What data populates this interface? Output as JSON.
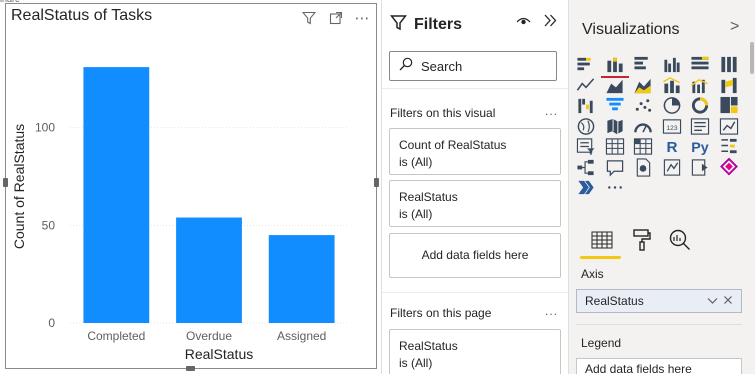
{
  "visual": {
    "cut_text": "ihare",
    "title": "RealStatus of Tasks",
    "header_icons": [
      "filter-icon",
      "focus-mode-icon",
      "more-options-icon"
    ],
    "more_label": "⋯"
  },
  "chart_data": {
    "type": "bar",
    "title": "RealStatus of Tasks",
    "xlabel": "RealStatus",
    "ylabel": "Count of RealStatus",
    "categories": [
      "Completed",
      "Overdue",
      "Assigned"
    ],
    "values": [
      131,
      54,
      45
    ],
    "yticks": [
      0,
      50,
      100
    ],
    "ylim": [
      0,
      150
    ],
    "grid": true,
    "bar_color": "#118DFF"
  },
  "filters": {
    "title": "Filters",
    "search_placeholder": "Search",
    "on_visual_label": "Filters on this visual",
    "on_page_label": "Filters on this page",
    "more_label": "...",
    "visual_cards": [
      {
        "name": "Count of RealStatus",
        "state": "is (All)"
      },
      {
        "name": "RealStatus",
        "state": "is (All)"
      }
    ],
    "add_fields": "Add data fields here",
    "page_cards": [
      {
        "name": "RealStatus",
        "state": "is (All)"
      }
    ]
  },
  "visualizations": {
    "title": "Visualizations",
    "chevron": ">",
    "more_label": "...",
    "axis_label": "Axis",
    "axis_value": "RealStatus",
    "legend_label": "Legend",
    "legend_placeholder": "Add data fields here",
    "r_label": "R",
    "py_label": "Py",
    "icons": [
      "stacked-bar-icon",
      "stacked-column-icon",
      "clustered-bar-icon",
      "clustered-column-icon",
      "100-bar-icon",
      "100-column-icon",
      "line-chart-icon",
      "area-chart-icon",
      "stacked-area-icon",
      "line-column-icon",
      "line-clustered-icon",
      "ribbon-icon",
      "waterfall-icon",
      "funnel-icon",
      "scatter-icon",
      "pie-icon",
      "donut-icon",
      "treemap-icon",
      "map-icon",
      "filled-map-icon",
      "gauge-icon",
      "card-icon",
      "multi-row-card-icon",
      "kpi-icon",
      "slicer-icon",
      "table-icon",
      "matrix-icon",
      "r-visual-icon",
      "python-visual-icon",
      "key-influencers-icon",
      "decomposition-tree-icon",
      "qa-icon",
      "paginated-report-icon",
      "arcgis-icon",
      "power-apps-icon",
      "power-automate-icon",
      "smart-narrative-icon",
      "more-visuals-icon"
    ],
    "tabs": [
      "fields-tab-icon",
      "format-tab-icon",
      "analytics-tab-icon"
    ],
    "colors": {
      "accent_blue": "#118DFF",
      "selected_underline": "#C4262E",
      "tab_underline": "#F2C811"
    }
  }
}
